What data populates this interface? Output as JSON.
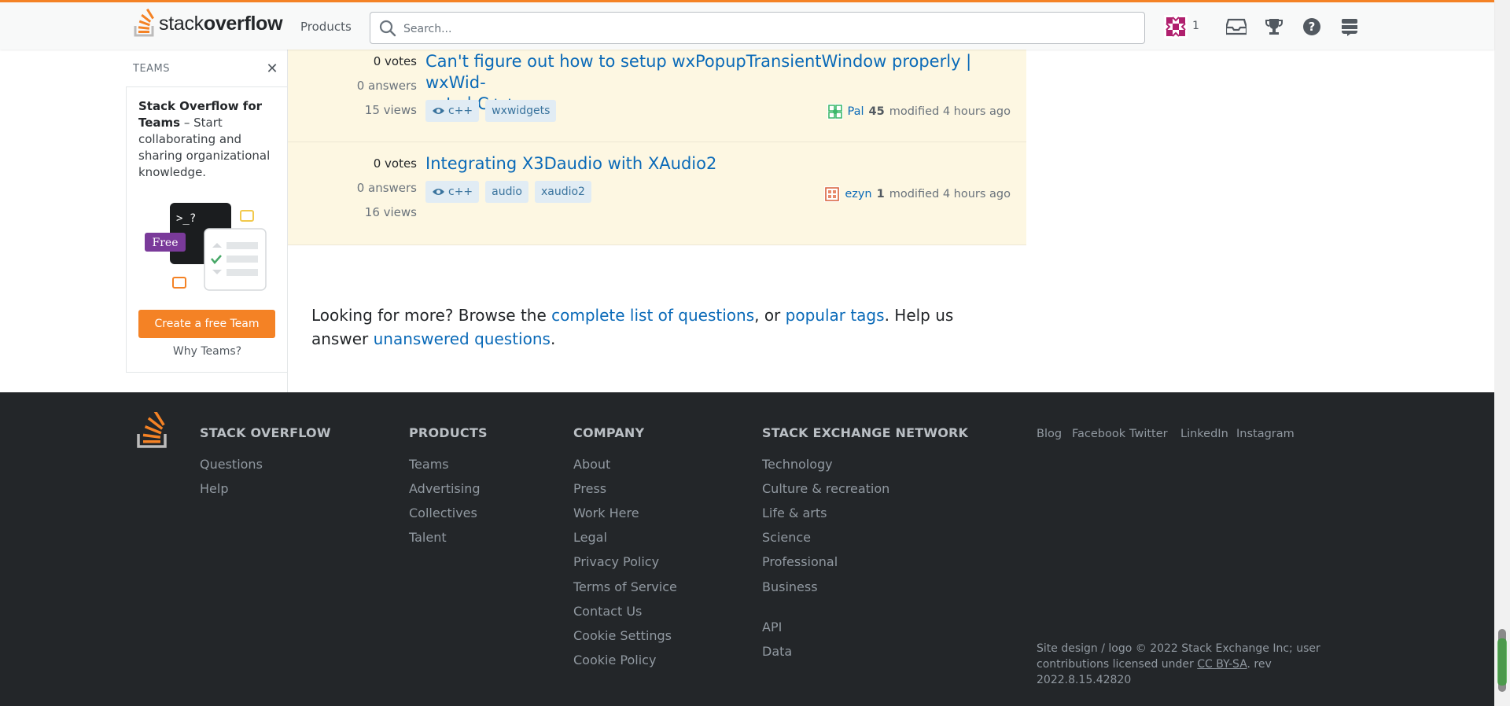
{
  "topbar": {
    "logo_regular": "stack",
    "logo_bold": "overflow",
    "products_label": "Products",
    "search_placeholder": "Search...",
    "reputation": "1"
  },
  "sidebar": {
    "heading": "TEAMS",
    "close_glyph": "✕",
    "card_title": "Stack Overflow for Teams",
    "card_body": " – Start collaborating and sharing organizational knowledge.",
    "illus_badge": "Free",
    "illus_prompt": ">_?",
    "cta_label": "Create a free Team",
    "why_label": "Why Teams?"
  },
  "questions": [
    {
      "votes": "0 votes",
      "answers": "0 answers",
      "views": "15 views",
      "title_line1": "Can't figure out how to setup wxPopupTransientWindow properly | wxWid-",
      "title_line2": "gets | C++",
      "tags": [
        "c++",
        "wxwidgets"
      ],
      "user": "Pal",
      "user_rep": "45",
      "activity": "modified 4 hours ago"
    },
    {
      "votes": "0 votes",
      "answers": "0 answers",
      "views": "16 views",
      "title_line1": "Integrating X3Daudio with XAudio2",
      "title_line2": "",
      "tags": [
        "c++",
        "audio",
        "xaudio2"
      ],
      "user": "ezyn",
      "user_rep": "1",
      "activity": "modified 4 hours ago"
    }
  ],
  "more": {
    "prefix": "Looking for more? Browse the ",
    "link1": "complete list of questions",
    "mid": ", or ",
    "link2": "popular tags",
    "mid2": ". Help us answer ",
    "link3": "unanswered questions",
    "suffix": "."
  },
  "footer": {
    "col1": {
      "title": "STACK OVERFLOW",
      "links": [
        "Questions",
        "Help"
      ]
    },
    "col2": {
      "title": "PRODUCTS",
      "links": [
        "Teams",
        "Advertising",
        "Collectives",
        "Talent"
      ]
    },
    "col3": {
      "title": "COMPANY",
      "links": [
        "About",
        "Press",
        "Work Here",
        "Legal",
        "Privacy Policy",
        "Terms of Service",
        "Contact Us",
        "Cookie Settings",
        "Cookie Policy"
      ]
    },
    "col4": {
      "title": "STACK EXCHANGE NETWORK",
      "links": [
        "Technology",
        "Culture & recreation",
        "Life & arts",
        "Science",
        "Professional",
        "Business",
        "API",
        "Data"
      ]
    },
    "social": [
      "Blog",
      "Facebook",
      "Twitter",
      "LinkedIn",
      "Instagram"
    ],
    "copy_line1": "Site design / logo © 2022 Stack Exchange Inc; user",
    "copy_line2_prefix": "contributions licensed under ",
    "copy_license": "CC BY-SA",
    "copy_line2_suffix": ". rev 2022.8.15.42820"
  },
  "colors": {
    "accent_orange": "#f48225",
    "link_blue": "#0a6ab8",
    "highlight_row": "#fdf7e2",
    "footer_bg": "#232629"
  }
}
